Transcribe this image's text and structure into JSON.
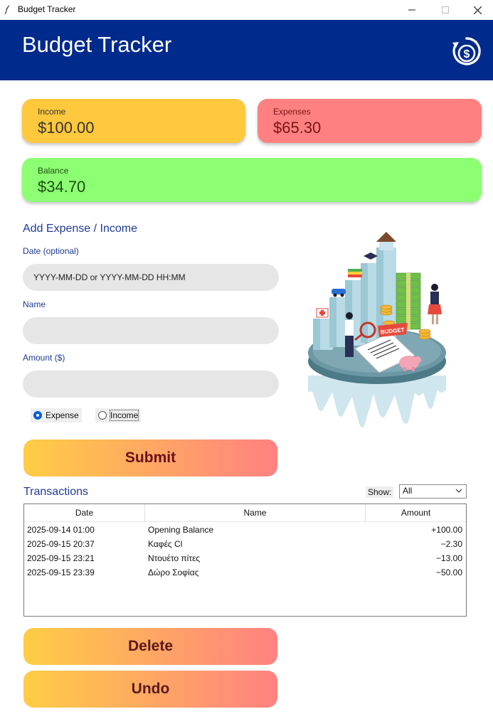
{
  "window": {
    "title": "Budget Tracker",
    "minimize": "–",
    "close": "✕"
  },
  "header": {
    "title": "Budget Tracker",
    "logo_icon": "dollar-cycle-icon",
    "logo_symbol": "$"
  },
  "summary": {
    "income": {
      "label": "Income",
      "value": "$100.00"
    },
    "expenses": {
      "label": "Expenses",
      "value": "$65.30"
    },
    "balance": {
      "label": "Balance",
      "value": "$34.70"
    }
  },
  "form": {
    "title": "Add Expense / Income",
    "date_label": "Date (optional)",
    "date_placeholder": "YYYY-MM-DD or YYYY-MM-DD HH:MM",
    "name_label": "Name",
    "name_value": "",
    "amount_label": "Amount ($)",
    "amount_value": "",
    "type_options": [
      {
        "label": "Expense",
        "selected": true
      },
      {
        "label": "Income",
        "selected": false
      }
    ],
    "submit_label": "Submit"
  },
  "illustration": {
    "sign_text": "BUDGET"
  },
  "transactions": {
    "title": "Transactions",
    "show_label": "Show:",
    "show_value": "All",
    "columns": [
      "Date",
      "Name",
      "Amount"
    ],
    "rows": [
      {
        "date": "2025-09-14 01:00",
        "name": "Opening Balance",
        "amount": "+100.00"
      },
      {
        "date": "2025-09-15 20:37",
        "name": "Καφές Cl",
        "amount": "−2.30"
      },
      {
        "date": "2025-09-15 23:21",
        "name": "Ντουέτο πίτες",
        "amount": "−13.00"
      },
      {
        "date": "2025-09-15 23:39",
        "name": "Δώρο Σοφίας",
        "amount": "−50.00"
      }
    ]
  },
  "actions": {
    "delete_label": "Delete",
    "undo_label": "Undo"
  },
  "colors": {
    "header": "#002a8c",
    "income_card": "#ffc83d",
    "expenses_card": "#ff8080",
    "balance_card": "#8cff73",
    "accent_text": "#1f3a93",
    "button_gradient_start": "#ffcd45",
    "button_gradient_end": "#ff8181"
  }
}
